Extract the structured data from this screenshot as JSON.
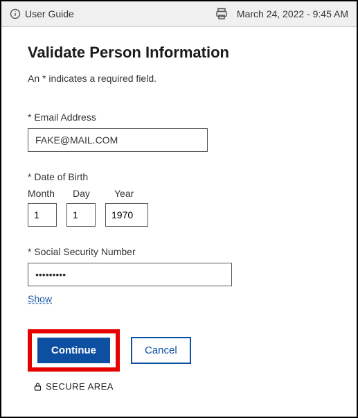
{
  "topbar": {
    "user_guide": "User Guide",
    "datetime": "March 24, 2022 - 9:45 AM"
  },
  "page": {
    "title": "Validate Person Information",
    "hint": "An * indicates a required field."
  },
  "email": {
    "label": "* Email Address",
    "value": "FAKE@MAIL.COM"
  },
  "dob": {
    "label": "* Date of Birth",
    "month_label": "Month",
    "day_label": "Day",
    "year_label": "Year",
    "month": "1",
    "day": "1",
    "year": "1970"
  },
  "ssn": {
    "label": "* Social Security Number",
    "value": "•••••••••",
    "show": "Show"
  },
  "buttons": {
    "continue": "Continue",
    "cancel": "Cancel"
  },
  "footer": {
    "secure": "SECURE AREA"
  }
}
